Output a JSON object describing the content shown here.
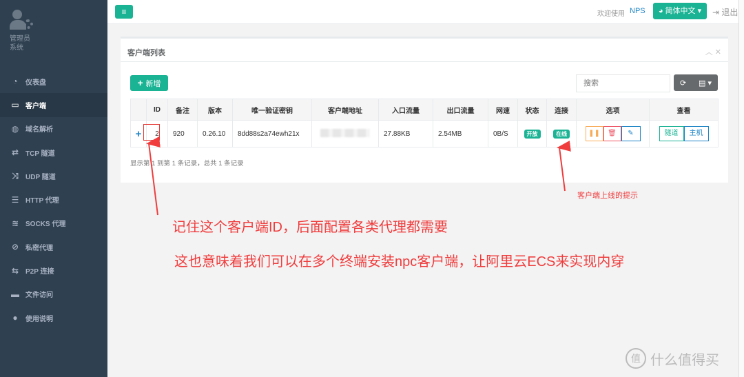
{
  "sidebar": {
    "user_name": "管理员",
    "user_role": "系统",
    "items": [
      {
        "label": "仪表盘",
        "icon": "dashboard-icon"
      },
      {
        "label": "客户端",
        "icon": "desktop-icon"
      },
      {
        "label": "域名解析",
        "icon": "globe-icon"
      },
      {
        "label": "TCP 隧道",
        "icon": "retweet-icon"
      },
      {
        "label": "UDP 隧道",
        "icon": "random-icon"
      },
      {
        "label": "HTTP 代理",
        "icon": "server-icon"
      },
      {
        "label": "SOCKS 代理",
        "icon": "layers-icon"
      },
      {
        "label": "私密代理",
        "icon": "eye-slash-icon"
      },
      {
        "label": "P2P 连接",
        "icon": "exchange-icon"
      },
      {
        "label": "文件访问",
        "icon": "briefcase-icon"
      },
      {
        "label": "使用说明",
        "icon": "lightbulb-icon"
      }
    ]
  },
  "topbar": {
    "welcome": "欢迎使用",
    "brand": "NPS",
    "language": "简体中文",
    "logout": "退出"
  },
  "panel": {
    "title": "客户端列表",
    "add_label": "新增",
    "search_placeholder": "搜索",
    "columns": [
      "ID",
      "备注",
      "版本",
      "唯一验证密钥",
      "客户端地址",
      "入口流量",
      "出口流量",
      "网速",
      "状态",
      "连接",
      "选项",
      "查看"
    ],
    "rows": [
      {
        "id": "2",
        "remark": "920",
        "version": "0.26.10",
        "vkey": "8dd88s2a74ewh21x",
        "addr": "",
        "in_flow": "27.88KB",
        "out_flow": "2.54MB",
        "speed": "0B/S",
        "status": "开放",
        "connect": "在线",
        "view_tunnel": "隧道",
        "view_host": "主机"
      }
    ],
    "pagination_info": "显示第 1 到第 1 条记录，总共 1 条记录"
  },
  "annotations": {
    "online_hint": "客户端上线的提示",
    "line1": "记住这个客户端ID，后面配置各类代理都需要",
    "line2": "这也意味着我们可以在多个终端安装npc客户端，让阿里云ECS来实现内穿"
  },
  "watermark": "什么值得买",
  "colors": {
    "accent": "#1ab394",
    "sidebar": "#2f4050",
    "annotation": "#f03c3c"
  }
}
